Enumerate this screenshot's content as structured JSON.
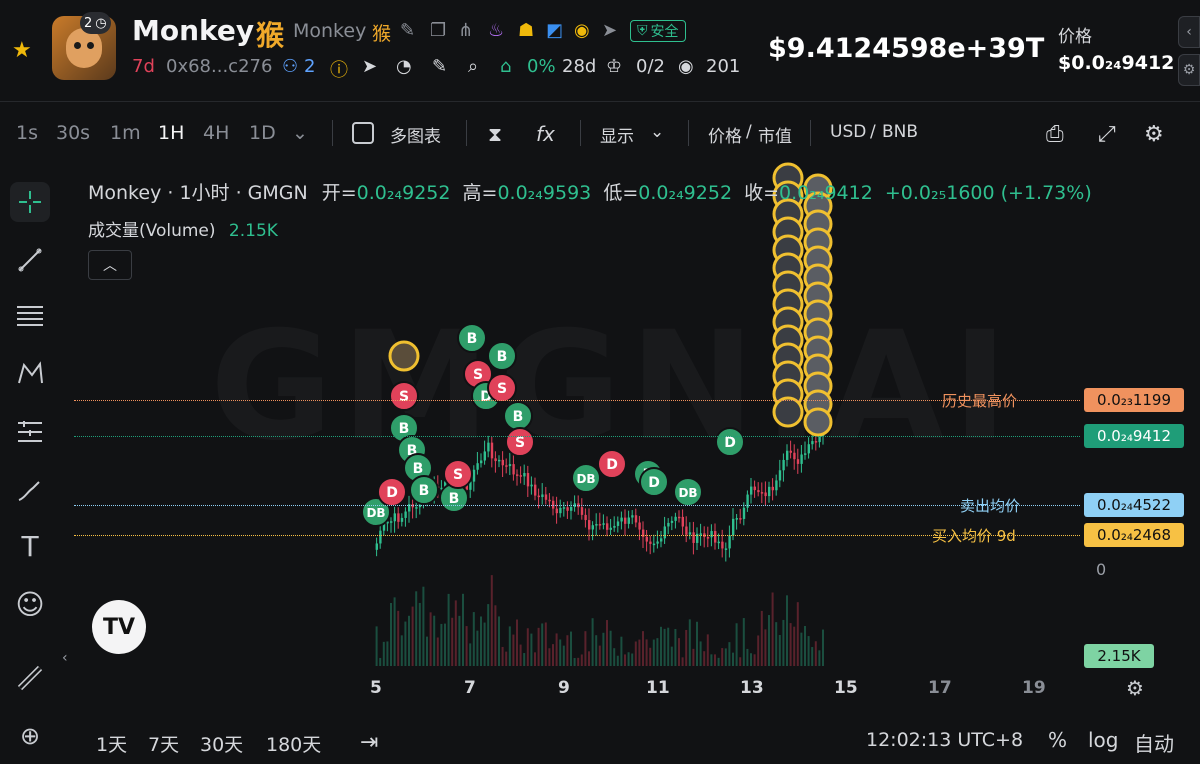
{
  "header": {
    "avatar_badge_count": "2",
    "token_name": "Monkey",
    "token_cn_name": "猴",
    "token_symbol": "Monkey",
    "token_symbol_cn": "猴",
    "safe_label": "安全",
    "age": "7d",
    "contract": "0x68...c276",
    "holders_count": "2",
    "holder_pct": "0%",
    "holder_days": "28d",
    "crown_ratio": "0/2",
    "views": "201",
    "market_cap": "$9.4124598e+39T",
    "price_label": "价格",
    "price_value": "$0.0₂₄9412"
  },
  "toolbar": {
    "timeframes": [
      "1s",
      "30s",
      "1m",
      "1H",
      "4H",
      "1D"
    ],
    "active_timeframe": "1H",
    "multi_chart": "多图表",
    "display": "显示",
    "price_toggle": "价格",
    "mcap_toggle": "市值",
    "currency_usd": "USD",
    "currency_bnb": "BNB"
  },
  "legend": {
    "title": "Monkey · 1小时 · GMGN",
    "open_label": "开=",
    "open_value": "0.0₂₄9252",
    "high_label": "高=",
    "high_value": "0.0₂₄9593",
    "low_label": "低=",
    "low_value": "0.0₂₄9252",
    "close_label": "收=",
    "close_value": "0.0₂₄9412",
    "change_value": "+0.0₂₅1600 (+1.73%)",
    "volume_label": "成交量(Volume)",
    "volume_value": "2.15K"
  },
  "watermark": "GMGN.AI",
  "levels": {
    "ath_label": "历史最高价",
    "ath_value": "0.0₂₃1199",
    "current_value": "0.0₂₄9412",
    "sell_avg_label": "卖出均价",
    "sell_avg_value": "0.0₂₄4522",
    "buy_avg_label": "买入均价 9d",
    "buy_avg_value": "0.0₂₄2468",
    "zero_label": "0",
    "volume_tag": "2.15K"
  },
  "colors": {
    "up": "#2fbf8f",
    "down": "#e0425a",
    "ath": "#f0925e",
    "current": "#1f9d78",
    "sell": "#8fd0f5",
    "buy": "#f7c144",
    "bg": "#111214"
  },
  "chart_data": {
    "type": "candlestick",
    "x_ticks": [
      "5",
      "7",
      "9",
      "11",
      "13",
      "15",
      "17",
      "19"
    ],
    "markers": {
      "buy_label": "B",
      "sell_label": "S",
      "dev_buy_label": "DB",
      "dev_label": "D"
    }
  },
  "bottom": {
    "ranges": [
      "1天",
      "7天",
      "30天",
      "180天"
    ],
    "clock": "12:02:13 UTC+8",
    "percent": "%",
    "log": "log",
    "auto": "自动"
  },
  "icons": {
    "star": "star-icon",
    "tv": "TV"
  }
}
